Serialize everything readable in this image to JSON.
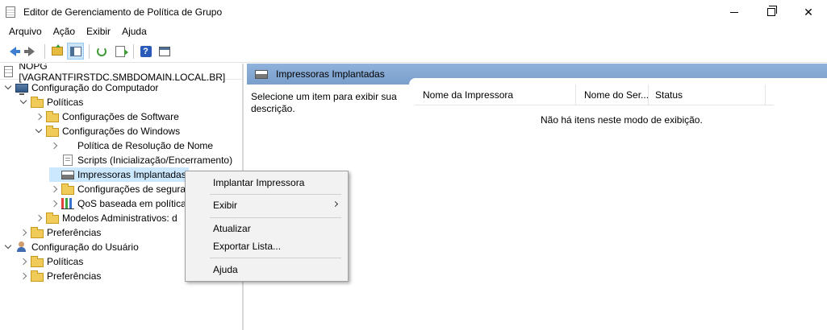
{
  "window": {
    "title": "Editor de Gerenciamento de Política de Grupo"
  },
  "menubar": [
    "Arquivo",
    "Ação",
    "Exibir",
    "Ajuda"
  ],
  "toolbar": {
    "icons": [
      "back-arrow-icon",
      "forward-arrow-icon",
      "up-folder-icon",
      "show-hide-tree-icon",
      "refresh-icon",
      "export-list-icon",
      "help-icon",
      "properties-icon"
    ]
  },
  "tree": {
    "root": "NOPG [VAGRANTFIRSTDC.SMBDOMAIN.LOCAL.BR]",
    "items": [
      {
        "label": "Configuração do Computador"
      },
      {
        "label": "Políticas"
      },
      {
        "label": "Configurações de Software"
      },
      {
        "label": "Configurações do Windows"
      },
      {
        "label": "Política de Resolução de Nome"
      },
      {
        "label": "Scripts (Inicialização/Encerramento)"
      },
      {
        "label": "Impressoras Implantadas"
      },
      {
        "label": "Configurações de segurança"
      },
      {
        "label": "QoS baseada em política"
      },
      {
        "label": "Modelos Administrativos: d"
      },
      {
        "label": "Preferências"
      },
      {
        "label": "Configuração do Usuário"
      },
      {
        "label": "Políticas"
      },
      {
        "label": "Preferências"
      }
    ]
  },
  "details": {
    "header": "Impressoras Implantadas",
    "description": "Selecione um item para exibir sua descrição.",
    "columns": [
      "Nome da Impressora",
      "Nome do Ser...",
      "Status"
    ],
    "empty_message": "Não há itens neste modo de exibição."
  },
  "context_menu": {
    "items": [
      "Implantar Impressora",
      "Exibir",
      "Atualizar",
      "Exportar Lista...",
      "Ajuda"
    ]
  },
  "colors": {
    "selection": "#cce8ff",
    "header_band": "#8eb2db"
  }
}
